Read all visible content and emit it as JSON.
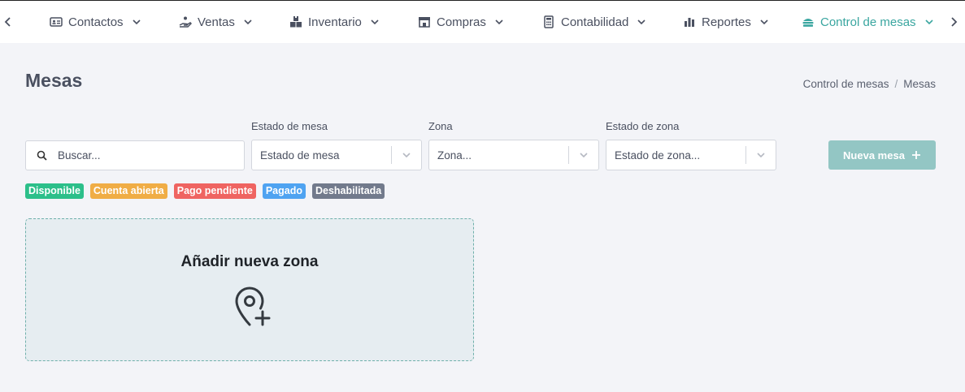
{
  "nav": {
    "items": [
      {
        "label": "Contactos",
        "icon": "contacts-card-icon"
      },
      {
        "label": "Ventas",
        "icon": "hand-money-icon"
      },
      {
        "label": "Inventario",
        "icon": "boxes-icon"
      },
      {
        "label": "Compras",
        "icon": "store-icon"
      },
      {
        "label": "Contabilidad",
        "icon": "calculator-icon"
      },
      {
        "label": "Reportes",
        "icon": "bar-chart-icon"
      },
      {
        "label": "Control de mesas",
        "icon": "table-icon",
        "active": true
      }
    ],
    "active_color": "#3aa6a0"
  },
  "page": {
    "title": "Mesas",
    "breadcrumb": [
      "Control de mesas",
      "/",
      "Mesas"
    ]
  },
  "filters": {
    "search_placeholder": "Buscar...",
    "estado_mesa": {
      "label": "Estado de mesa",
      "value": "Estado de mesa"
    },
    "zona": {
      "label": "Zona",
      "value": "Zona..."
    },
    "estado_zona": {
      "label": "Estado de zona",
      "value": "Estado de zona..."
    }
  },
  "new_button": {
    "label": "Nueva mesa",
    "color": "#93c6c4"
  },
  "legend": [
    {
      "label": "Disponible",
      "color": "#2cbf8a"
    },
    {
      "label": "Cuenta abierta",
      "color": "#f0ad45"
    },
    {
      "label": "Pago pendiente",
      "color": "#ef6461"
    },
    {
      "label": "Pagado",
      "color": "#4fa3f1"
    },
    {
      "label": "Deshabilitada",
      "color": "#727a8c"
    }
  ],
  "zone_card": {
    "title": "Añadir nueva zona",
    "icon": "map-pin-plus-icon"
  }
}
